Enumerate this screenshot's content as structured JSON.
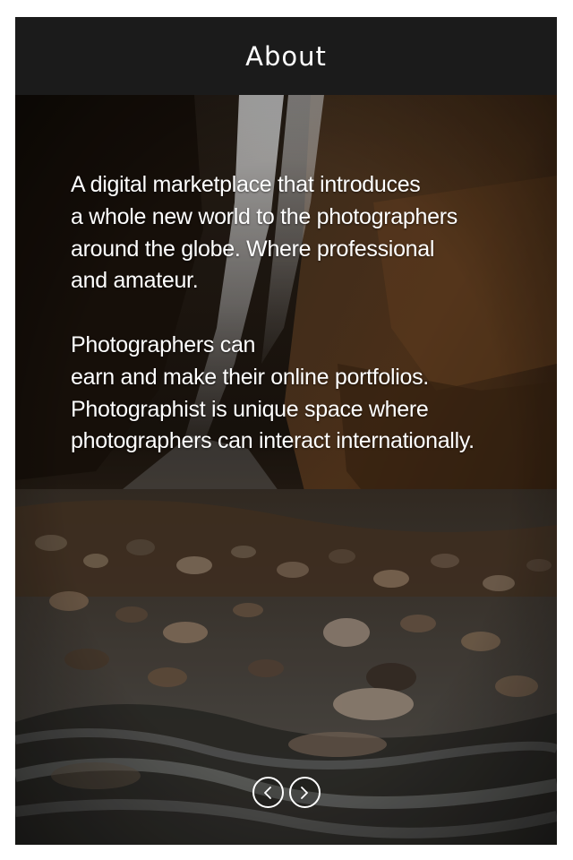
{
  "header": {
    "title": "About"
  },
  "about": {
    "paragraph1": [
      "A digital marketplace that introduces",
      "a whole new world to the photographers",
      "around the globe. Where professional",
      "and amateur."
    ],
    "paragraph2": [
      "Photographers can",
      "earn and make their online portfolios.",
      "Photographist is unique space where",
      "photographers can interact internationally."
    ]
  },
  "pager": {
    "prev_icon": "chevron-left-icon",
    "next_icon": "chevron-right-icon"
  },
  "colors": {
    "header_bg": "#1b1b1b",
    "text": "#ffffff"
  }
}
